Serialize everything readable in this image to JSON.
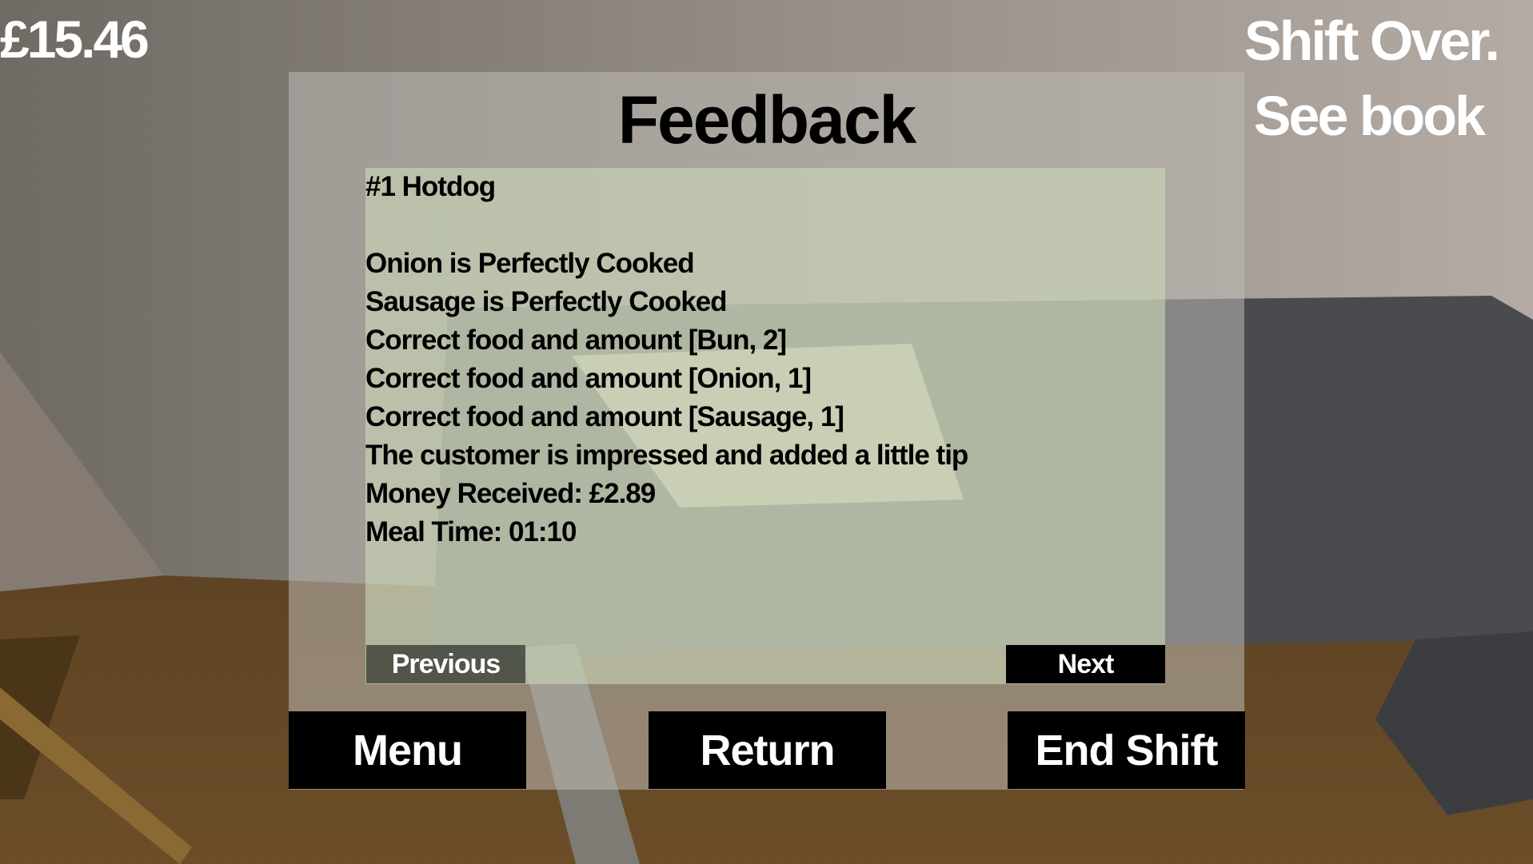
{
  "hud": {
    "money": "£15.46",
    "shift_status_line1": "Shift Over.",
    "shift_status_line2": "See book"
  },
  "feedback": {
    "title": "Feedback",
    "lines": [
      "#1 Hotdog",
      "",
      "Onion is Perfectly Cooked",
      "Sausage is Perfectly Cooked",
      "Correct food and amount [Bun, 2]",
      "Correct food and amount [Onion, 1]",
      "Correct food and amount [Sausage, 1]",
      "The customer is impressed and added a little tip",
      "Money Received: £2.89",
      "Meal Time: 01:10"
    ],
    "previous_label": "Previous",
    "next_label": "Next"
  },
  "buttons": {
    "menu": "Menu",
    "return": "Return",
    "end_shift": "End Shift"
  }
}
